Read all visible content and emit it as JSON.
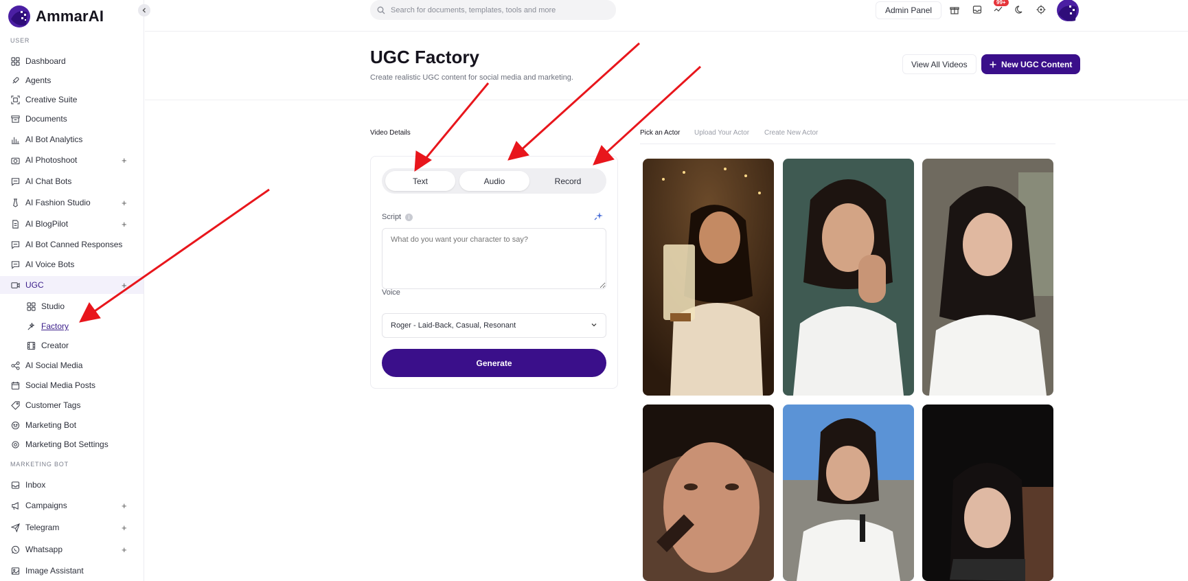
{
  "brand": {
    "name": "AmmarAI"
  },
  "sidebar": {
    "section_user": "USER",
    "section_marketing": "MARKETING BOT",
    "items": [
      {
        "label": "Dashboard",
        "icon": "grid-icon",
        "plus": ""
      },
      {
        "label": "Agents",
        "icon": "rocket-icon",
        "plus": ""
      },
      {
        "label": "Creative Suite",
        "icon": "scan-icon",
        "plus": ""
      },
      {
        "label": "Documents",
        "icon": "archive-icon",
        "plus": ""
      },
      {
        "label": "AI Bot Analytics",
        "icon": "bar-chart-icon",
        "plus": ""
      },
      {
        "label": "AI Photoshoot",
        "icon": "camera-icon",
        "plus": "+"
      },
      {
        "label": "AI Chat Bots",
        "icon": "chat-icon",
        "plus": ""
      },
      {
        "label": "AI Fashion Studio",
        "icon": "tie-icon",
        "plus": "+"
      },
      {
        "label": "AI BlogPilot",
        "icon": "file-icon",
        "plus": "+"
      },
      {
        "label": "AI Bot Canned Responses",
        "icon": "chat-icon",
        "plus": ""
      },
      {
        "label": "AI Voice Bots",
        "icon": "chat-icon",
        "plus": ""
      },
      {
        "label": "UGC",
        "icon": "video-icon",
        "plus": "+"
      }
    ],
    "ugc_sub": [
      {
        "label": "Studio",
        "icon": "grid-icon"
      },
      {
        "label": "Factory",
        "icon": "wand-icon"
      },
      {
        "label": "Creator",
        "icon": "film-icon"
      }
    ],
    "items_after": [
      {
        "label": "AI Social Media",
        "icon": "share-icon",
        "plus": ""
      },
      {
        "label": "Social Media Posts",
        "icon": "calendar-icon",
        "plus": ""
      },
      {
        "label": "Customer Tags",
        "icon": "tag-icon",
        "plus": ""
      },
      {
        "label": "Marketing Bot",
        "icon": "bot-icon",
        "plus": ""
      },
      {
        "label": "Marketing Bot Settings",
        "icon": "gear-icon",
        "plus": ""
      }
    ],
    "marketing_items": [
      {
        "label": "Inbox",
        "icon": "inbox-icon",
        "plus": ""
      },
      {
        "label": "Campaigns",
        "icon": "megaphone-icon",
        "plus": "+"
      },
      {
        "label": "Telegram",
        "icon": "send-icon",
        "plus": "+"
      },
      {
        "label": "Whatsapp",
        "icon": "whatsapp-icon",
        "plus": "+"
      },
      {
        "label": "Image Assistant",
        "icon": "image-icon",
        "plus": ""
      }
    ]
  },
  "topbar": {
    "search_placeholder": "Search for documents, templates, tools and more",
    "admin_label": "Admin Panel",
    "notifications_badge": "99+"
  },
  "page": {
    "title": "UGC Factory",
    "subtitle": "Create realistic UGC content for social media and marketing.",
    "view_all_label": "View All Videos",
    "new_ugc_label": "New UGC Content"
  },
  "tabs": {
    "details_label": "Video Details",
    "actor_tabs": [
      "Pick an Actor",
      "Upload Your Actor",
      "Create New Actor"
    ]
  },
  "form": {
    "modes": [
      "Text",
      "Audio",
      "Record"
    ],
    "script_label": "Script",
    "script_placeholder": "What do you want your character to say?",
    "voice_label": "Voice",
    "voice_value": "Roger - Laid-Back, Casual, Resonant",
    "generate_label": "Generate"
  },
  "colors": {
    "accent": "#3a0f8a",
    "badge": "#e5343a",
    "arrow": "#e8161c"
  }
}
